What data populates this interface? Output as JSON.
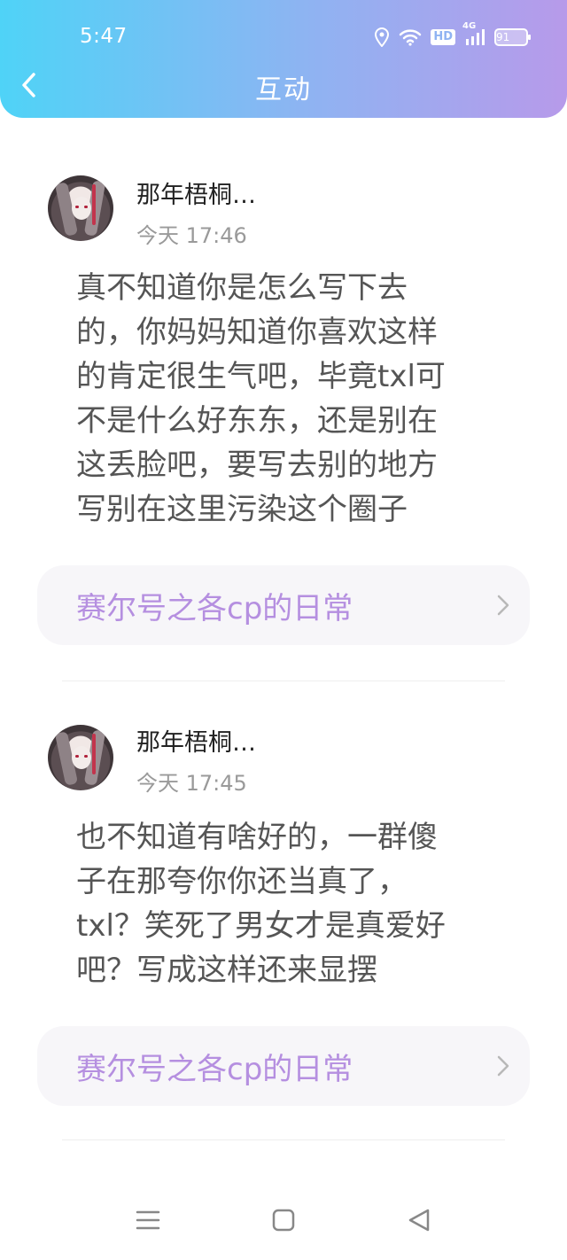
{
  "status_bar": {
    "time": "5:47",
    "battery": "91",
    "network": "4G",
    "hd": "HD",
    "icons": [
      "location-icon",
      "wifi-icon",
      "hd-icon",
      "signal-4g-icon",
      "battery-icon"
    ]
  },
  "header": {
    "title": "互动",
    "back_icon": "chevron-left-icon"
  },
  "comments": [
    {
      "username": "那年梧桐…",
      "time": "今天 17:46",
      "text_lines": [
        "真不知道你是怎么写下去",
        "的，你妈妈知道你喜欢这样",
        "的肯定很生气吧，毕竟txl可",
        "不是什么好东东，还是别在",
        "这丢脸吧，要写去别的地方",
        "写别在这里污染这个圈子"
      ],
      "source": "赛尔号之各cp的日常"
    },
    {
      "username": "那年梧桐…",
      "time": "今天 17:45",
      "text_lines": [
        "也不知道有啥好的，一群傻",
        "子在那夸你你还当真了，",
        "txl？笑死了男女才是真爱好",
        "吧？写成这样还来显摆"
      ],
      "source": "赛尔号之各cp的日常"
    }
  ],
  "colors": {
    "header_gradient_start": "#4fd3f7",
    "header_gradient_end": "#b79aea",
    "link_text": "#b58fe0",
    "timestamp": "#9a9a9a"
  },
  "system_nav": [
    "menu-icon",
    "home-icon",
    "back-triangle-icon"
  ]
}
